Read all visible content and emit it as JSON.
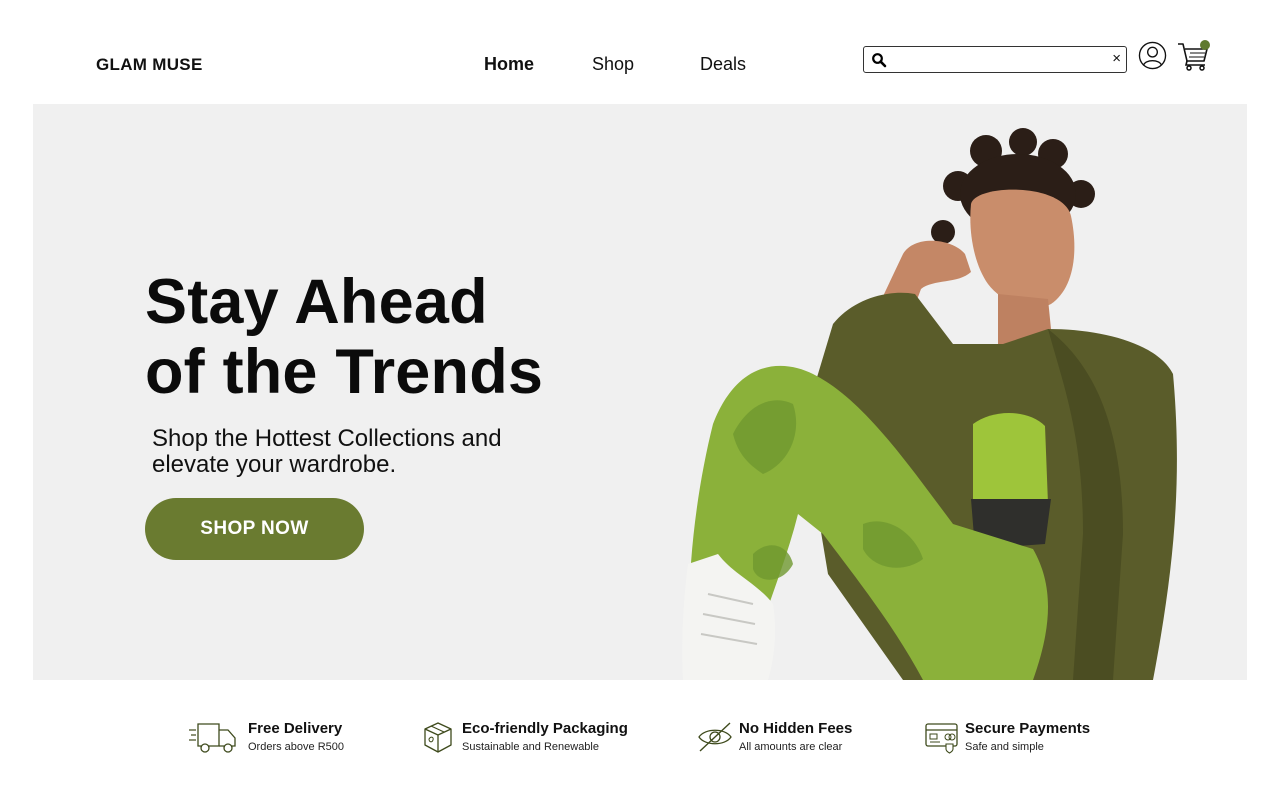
{
  "brand": {
    "name": "GLAM MUSE",
    "accent_color": "#6a7b30"
  },
  "nav": {
    "items": [
      "Home",
      "Shop",
      "Deals"
    ],
    "active": "Home"
  },
  "search": {
    "value": "",
    "placeholder": "",
    "clear_label": "×",
    "icon": "search-icon"
  },
  "header_icons": {
    "account": "user-icon",
    "cart": "cart-icon",
    "cart_badge_color": "#5f7a2e"
  },
  "hero": {
    "title_line1": "Stay Ahead",
    "title_line2": "of the Trends",
    "subtitle": "Shop the Hottest Collections and elevate your wardrobe.",
    "cta_label": "SHOP NOW",
    "background_color": "#f0f0f0"
  },
  "features": [
    {
      "icon": "delivery-truck-icon",
      "title": "Free Delivery",
      "subtitle": "Orders above R500"
    },
    {
      "icon": "package-box-icon",
      "title": "Eco-friendly Packaging",
      "subtitle": "Sustainable and Renewable"
    },
    {
      "icon": "hidden-eye-icon",
      "title": "No Hidden Fees",
      "subtitle": "All amounts are clear"
    },
    {
      "icon": "secure-card-icon",
      "title": "Secure Payments",
      "subtitle": "Safe and simple"
    }
  ]
}
